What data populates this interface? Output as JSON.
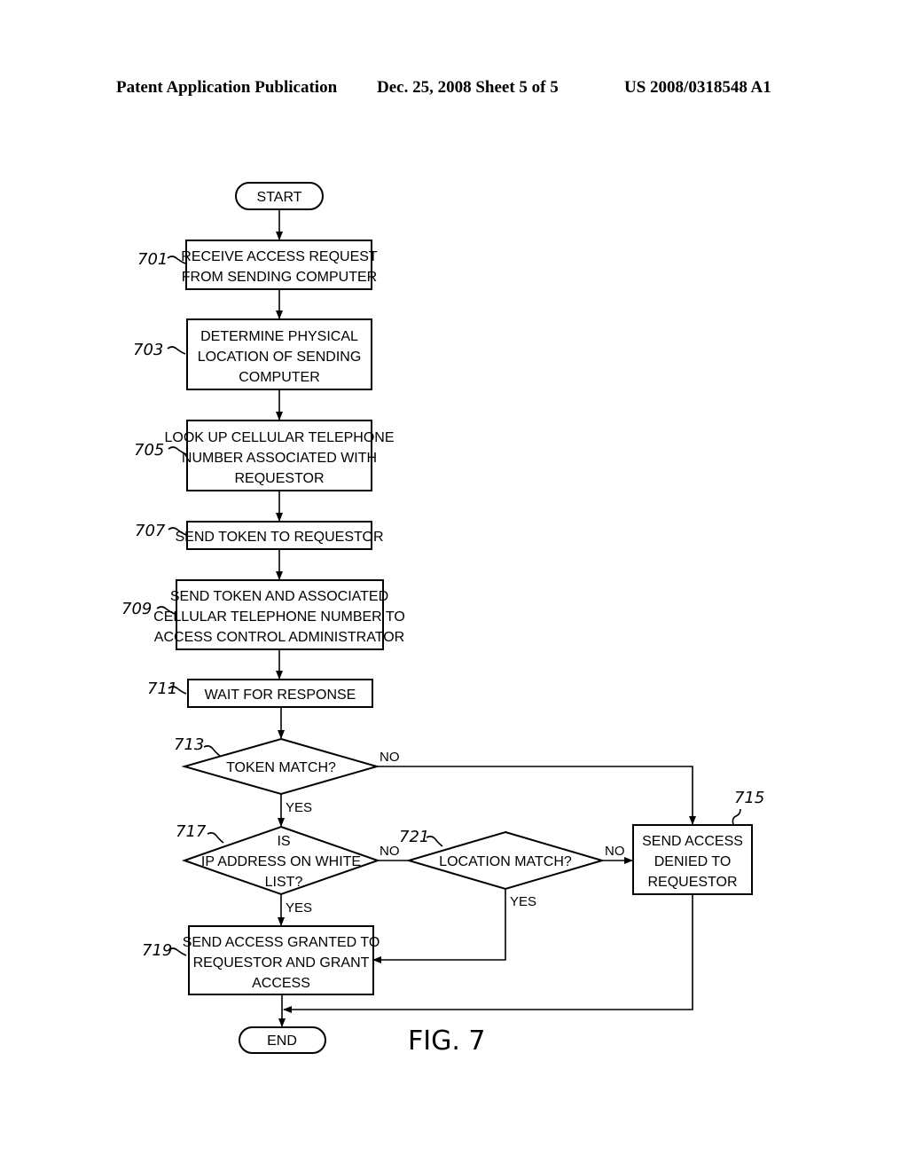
{
  "header": {
    "left": "Patent Application Publication",
    "middle": "Dec. 25, 2008   Sheet 5 of 5",
    "right": "US 2008/0318548 A1"
  },
  "flowchart": {
    "start": "START",
    "end": "END",
    "figure_label": "FIG. 7",
    "steps": {
      "s701": {
        "ref": "701",
        "lines": [
          "RECEIVE ACCESS REQUEST",
          "FROM SENDING COMPUTER"
        ]
      },
      "s703": {
        "ref": "703",
        "lines": [
          "DETERMINE PHYSICAL",
          "LOCATION OF SENDING",
          "COMPUTER"
        ]
      },
      "s705": {
        "ref": "705",
        "lines": [
          "LOOK UP CELLULAR TELEPHONE",
          "NUMBER ASSOCIATED WITH",
          "REQUESTOR"
        ]
      },
      "s707": {
        "ref": "707",
        "lines": [
          "SEND TOKEN TO REQUESTOR"
        ]
      },
      "s709": {
        "ref": "709",
        "lines": [
          "SEND TOKEN AND ASSOCIATED",
          "CELLULAR TELEPHONE NUMBER TO",
          "ACCESS CONTROL ADMINISTRATOR"
        ]
      },
      "s711": {
        "ref": "711",
        "lines": [
          "WAIT FOR RESPONSE"
        ]
      },
      "s713": {
        "ref": "713",
        "lines": [
          "TOKEN MATCH?"
        ]
      },
      "s715": {
        "ref": "715",
        "lines": [
          "SEND ACCESS",
          "DENIED TO",
          "REQUESTOR"
        ]
      },
      "s717": {
        "ref": "717",
        "lines": [
          "IS",
          "IP ADDRESS ON WHITE",
          "LIST?"
        ]
      },
      "s719": {
        "ref": "719",
        "lines": [
          "SEND ACCESS GRANTED TO",
          "REQUESTOR AND GRANT",
          "ACCESS"
        ]
      },
      "s721": {
        "ref": "721",
        "lines": [
          "LOCATION MATCH?"
        ]
      }
    },
    "edge_labels": {
      "yes": "YES",
      "no": "NO"
    }
  }
}
